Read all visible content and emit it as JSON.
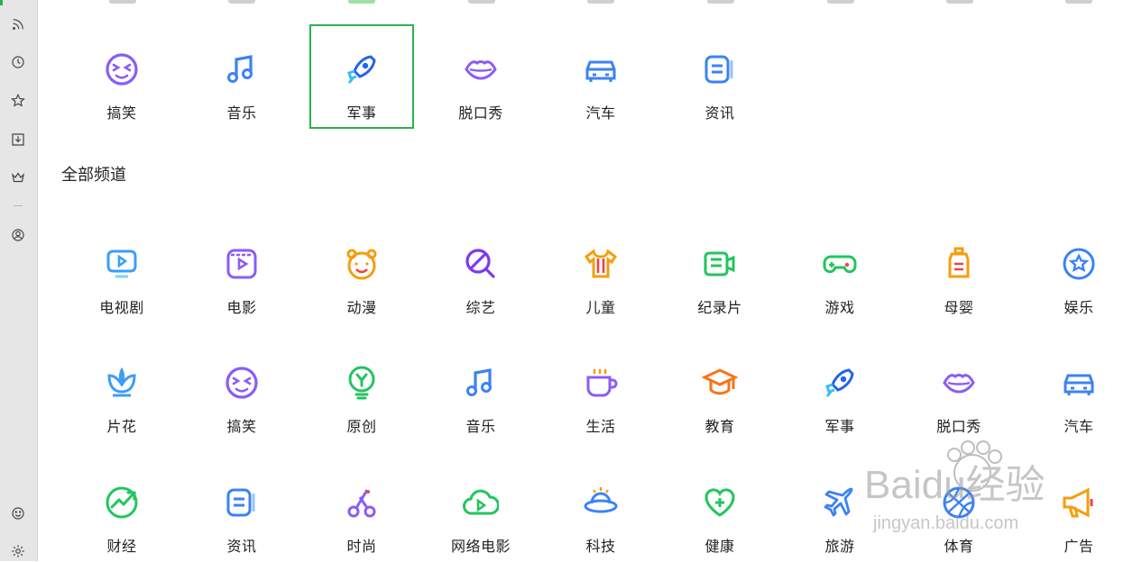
{
  "sidebar": {
    "icons": [
      "rss-icon",
      "clock-icon",
      "star-icon",
      "download-icon",
      "crown-icon",
      "user-icon",
      "smiley-icon",
      "gear-icon"
    ]
  },
  "favorites": [
    {
      "label": "搞笑",
      "icon": "funny-face-icon",
      "color": "#8b5cf6"
    },
    {
      "label": "音乐",
      "icon": "music-note-icon",
      "color": "#3b82f6"
    },
    {
      "label": "军事",
      "icon": "rocket-icon",
      "color": "#2563eb",
      "selected": true
    },
    {
      "label": "脱口秀",
      "icon": "lips-icon",
      "color": "#8b5cf6"
    },
    {
      "label": "汽车",
      "icon": "car-icon",
      "color": "#3b82f6"
    },
    {
      "label": "资讯",
      "icon": "news-icon",
      "color": "#3b82f6"
    }
  ],
  "section": {
    "title": "全部频道"
  },
  "channels": [
    {
      "label": "电视剧",
      "icon": "tv-icon",
      "color": "#3b9df8"
    },
    {
      "label": "电影",
      "icon": "film-icon",
      "color": "#8b5cf6"
    },
    {
      "label": "动漫",
      "icon": "bear-face-icon",
      "color": "#f59e0b"
    },
    {
      "label": "综艺",
      "icon": "magnifier-icon",
      "color": "#7c3aed"
    },
    {
      "label": "儿童",
      "icon": "kids-shirt-icon",
      "color": "#f59e0b"
    },
    {
      "label": "纪录片",
      "icon": "camera-truck-icon",
      "color": "#22c55e"
    },
    {
      "label": "游戏",
      "icon": "gamepad-icon",
      "color": "#22c55e"
    },
    {
      "label": "母婴",
      "icon": "baby-bottle-icon",
      "color": "#f59e0b"
    },
    {
      "label": "娱乐",
      "icon": "star-badge-icon",
      "color": "#3b82f6"
    },
    {
      "label": "片花",
      "icon": "flower-icon",
      "color": "#3b9df8"
    },
    {
      "label": "搞笑",
      "icon": "funny-face-icon",
      "color": "#8b5cf6"
    },
    {
      "label": "原创",
      "icon": "bulb-icon",
      "color": "#22c55e"
    },
    {
      "label": "音乐",
      "icon": "music-note-icon",
      "color": "#3b82f6"
    },
    {
      "label": "生活",
      "icon": "coffee-cup-icon",
      "color": "#8b5cf6"
    },
    {
      "label": "教育",
      "icon": "graduation-cap-icon",
      "color": "#f97316"
    },
    {
      "label": "军事",
      "icon": "rocket-icon",
      "color": "#2563eb"
    },
    {
      "label": "脱口秀",
      "icon": "lips-icon",
      "color": "#8b5cf6"
    },
    {
      "label": "汽车",
      "icon": "car-icon",
      "color": "#3b82f6"
    },
    {
      "label": "财经",
      "icon": "trend-up-icon",
      "color": "#22c55e"
    },
    {
      "label": "资讯",
      "icon": "news-icon",
      "color": "#3b82f6"
    },
    {
      "label": "时尚",
      "icon": "fashion-icon",
      "color": "#8b5cf6"
    },
    {
      "label": "网络电影",
      "icon": "cloud-play-icon",
      "color": "#22c55e"
    },
    {
      "label": "科技",
      "icon": "ufo-icon",
      "color": "#3b82f6"
    },
    {
      "label": "健康",
      "icon": "heart-plus-icon",
      "color": "#22c55e"
    },
    {
      "label": "旅游",
      "icon": "plane-icon",
      "color": "#3b82f6"
    },
    {
      "label": "体育",
      "icon": "ball-icon",
      "color": "#3b82f6"
    },
    {
      "label": "广告",
      "icon": "megaphone-icon",
      "color": "#f59e0b"
    }
  ],
  "watermark": {
    "text": "Baidu经验",
    "sub": "jingyan.baidu.com"
  }
}
